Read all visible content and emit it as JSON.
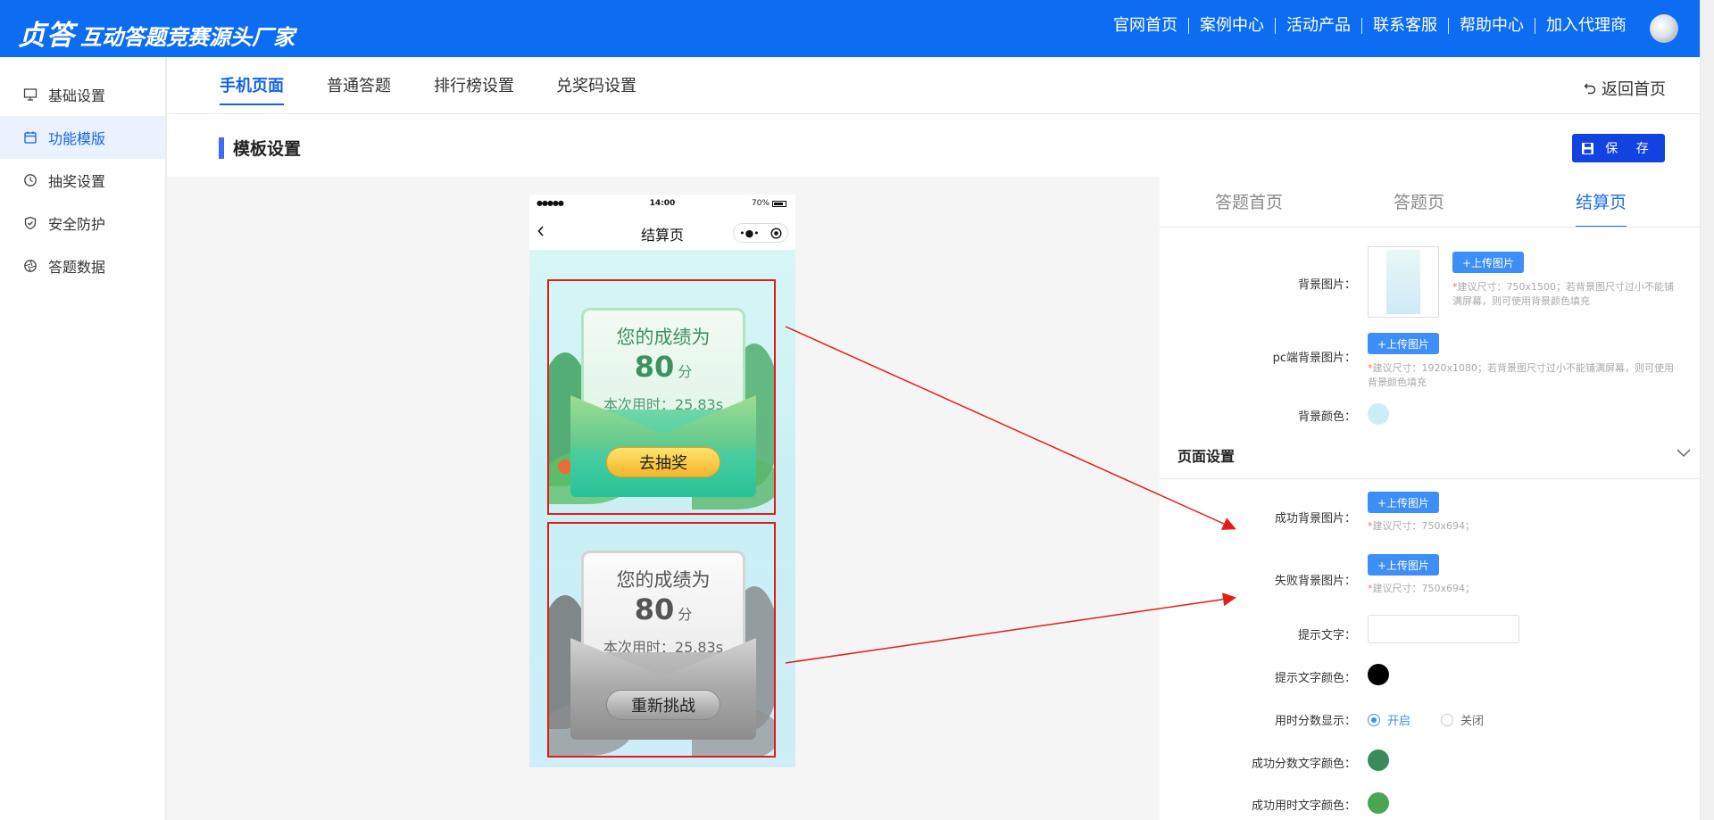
{
  "header": {
    "logo_main": "贞答",
    "logo_sub": "互动答题竞赛源头厂家",
    "nav": [
      "官网首页",
      "案例中心",
      "活动产品",
      "联系客服",
      "帮助中心",
      "加入代理商"
    ]
  },
  "sidebar": {
    "items": [
      {
        "label": "基础设置",
        "icon": "monitor-icon"
      },
      {
        "label": "功能模版",
        "icon": "calendar-icon"
      },
      {
        "label": "抽奖设置",
        "icon": "clock-icon"
      },
      {
        "label": "安全防护",
        "icon": "shield-icon"
      },
      {
        "label": "答题数据",
        "icon": "aperture-icon"
      }
    ],
    "active_index": 1
  },
  "tabs": {
    "items": [
      "手机页面",
      "普通答题",
      "排行榜设置",
      "兑奖码设置"
    ],
    "active_index": 0,
    "back_label": "返回首页"
  },
  "section": {
    "title": "模板设置",
    "save_label": "保 存"
  },
  "phone": {
    "status_signal": "●●●●●",
    "status_time": "14:00",
    "status_battery": "70%",
    "nav_title": "结算页",
    "capsule_dots": "•●•",
    "success_card": {
      "title": "您的成绩为",
      "score": "80",
      "unit": "分",
      "time_text": "本次用时：25.83s",
      "button": "去抽奖"
    },
    "fail_card": {
      "title": "您的成绩为",
      "score": "80",
      "unit": "分",
      "time_text": "本次用时：25.83s",
      "button": "重新挑战"
    }
  },
  "panel": {
    "tabs": [
      "答题首页",
      "答题页",
      "结算页"
    ],
    "active_tab": 2,
    "upload_label": "+上传图片",
    "bg_image_label": "背景图片：",
    "bg_image_hint": "建议尺寸：750x1500；若背景图尺寸过小不能铺满屏幕，则可使用背景颜色填充",
    "pc_bg_label": "pc端背景图片：",
    "pc_bg_hint": "建议尺寸：1920x1080；若背景图尺寸过小不能铺满屏幕，则可使用背景颜色填充",
    "bg_color_label": "背景颜色：",
    "bg_color": "#c9eef8",
    "page_settings_title": "页面设置",
    "success_bg_label": "成功背景图片：",
    "success_bg_hint": "建议尺寸：750x694；",
    "fail_bg_label": "失败背景图片：",
    "fail_bg_hint": "建议尺寸：750x694；",
    "tip_text_label": "提示文字：",
    "tip_text_value": "",
    "tip_color_label": "提示文字颜色：",
    "tip_color": "#000000",
    "time_score_label": "用时分数显示：",
    "radio_on": "开启",
    "radio_off": "关闭",
    "success_score_color_label": "成功分数文字颜色：",
    "success_score_color": "#3a8a5c",
    "success_time_color_label": "成功用时文字颜色：",
    "success_time_color": "#4aa552"
  },
  "colors": {
    "brand": "#0c6cf2",
    "accent": "#1363e8",
    "save": "#1243e0",
    "annotation": "#e51b1b"
  }
}
